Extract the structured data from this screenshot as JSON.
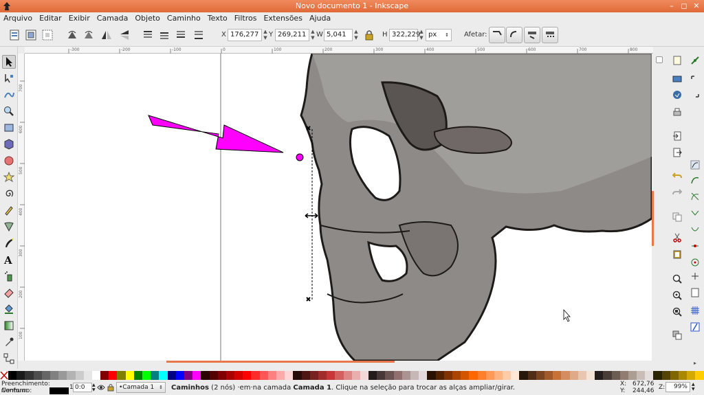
{
  "window": {
    "title": "Novo documento 1 - Inkscape"
  },
  "menu": [
    "Arquivo",
    "Editar",
    "Exibir",
    "Camada",
    "Objeto",
    "Caminho",
    "Texto",
    "Filtros",
    "Extensões",
    "Ajuda"
  ],
  "tool_controls": {
    "x_label": "X",
    "x_value": "176,277",
    "y_label": "Y",
    "y_value": "269,211",
    "w_label": "W",
    "w_value": "5,041",
    "h_label": "H",
    "h_value": "322,229",
    "unit": "px",
    "affect_label": "Afetar:"
  },
  "rulers": {
    "h_ticks": [
      "-300",
      "-200",
      "-100",
      "0",
      "100",
      "200",
      "300",
      "400",
      "500",
      "600",
      "700",
      "800"
    ],
    "v_ticks": [
      "700",
      "600",
      "500",
      "400",
      "300",
      "200",
      "100"
    ]
  },
  "palette": [
    "#000000",
    "#1a1a1a",
    "#333333",
    "#4d4d4d",
    "#666666",
    "#808080",
    "#999999",
    "#b3b3b3",
    "#cccccc",
    "#e6e6e6",
    "#ffffff",
    "#800000",
    "#ff0000",
    "#808000",
    "#ffff00",
    "#008000",
    "#00ff00",
    "#008080",
    "#00ffff",
    "#000080",
    "#0000ff",
    "#800080",
    "#ff00ff",
    "#2b0000",
    "#550000",
    "#800000",
    "#aa0000",
    "#d40000",
    "#ff0000",
    "#ff2a2a",
    "#ff5555",
    "#ff8080",
    "#ffaaaa",
    "#ffd5d5",
    "#280b0b",
    "#501616",
    "#782121",
    "#a02c2c",
    "#c83737",
    "#d35f5f",
    "#de8787",
    "#e9afaf",
    "#f4d7d7",
    "#241c1c",
    "#483737",
    "#6c5353",
    "#916f6f",
    "#ac9393",
    "#c8b7b7",
    "#e3dbdb",
    "#2b1100",
    "#552200",
    "#803300",
    "#aa4400",
    "#d45500",
    "#ff6600",
    "#ff7f2a",
    "#ff9955",
    "#ffb380",
    "#ffccaa",
    "#ffe6d5",
    "#28170b",
    "#502d16",
    "#784421",
    "#a05a2c",
    "#c87137",
    "#d38d5f",
    "#deaa87",
    "#e9c6af",
    "#f4e3d7",
    "#241f1c",
    "#483e37",
    "#6c5d53",
    "#917c6f",
    "#ac9d93",
    "#c8beb7",
    "#e3dedb",
    "#2b2200",
    "#554400",
    "#806600",
    "#aa8800",
    "#d4aa00",
    "#ffcc00"
  ],
  "status": {
    "fill_label": "Preenchimento:",
    "fill_value": "Nenhum",
    "stroke_label": "Contorno:",
    "stroke_width": "1",
    "opacity_value": "0:0",
    "layer_select": "•Camada 1",
    "message_bold": "Caminhos",
    "message_rest1": " (2 nós) ·em·na camada ",
    "message_layer": "Camada 1",
    "message_rest2": ". Clique na seleção para trocar as alças ampliar/girar.",
    "x_label": "X:",
    "x_val": "672,76",
    "y_label": "Y:",
    "y_val": "244,46",
    "zoom_label": "Z:",
    "zoom_val": "99%"
  },
  "colors": {
    "title_bar": "#e8774a",
    "annotation_arrow": "#ff00ff"
  }
}
